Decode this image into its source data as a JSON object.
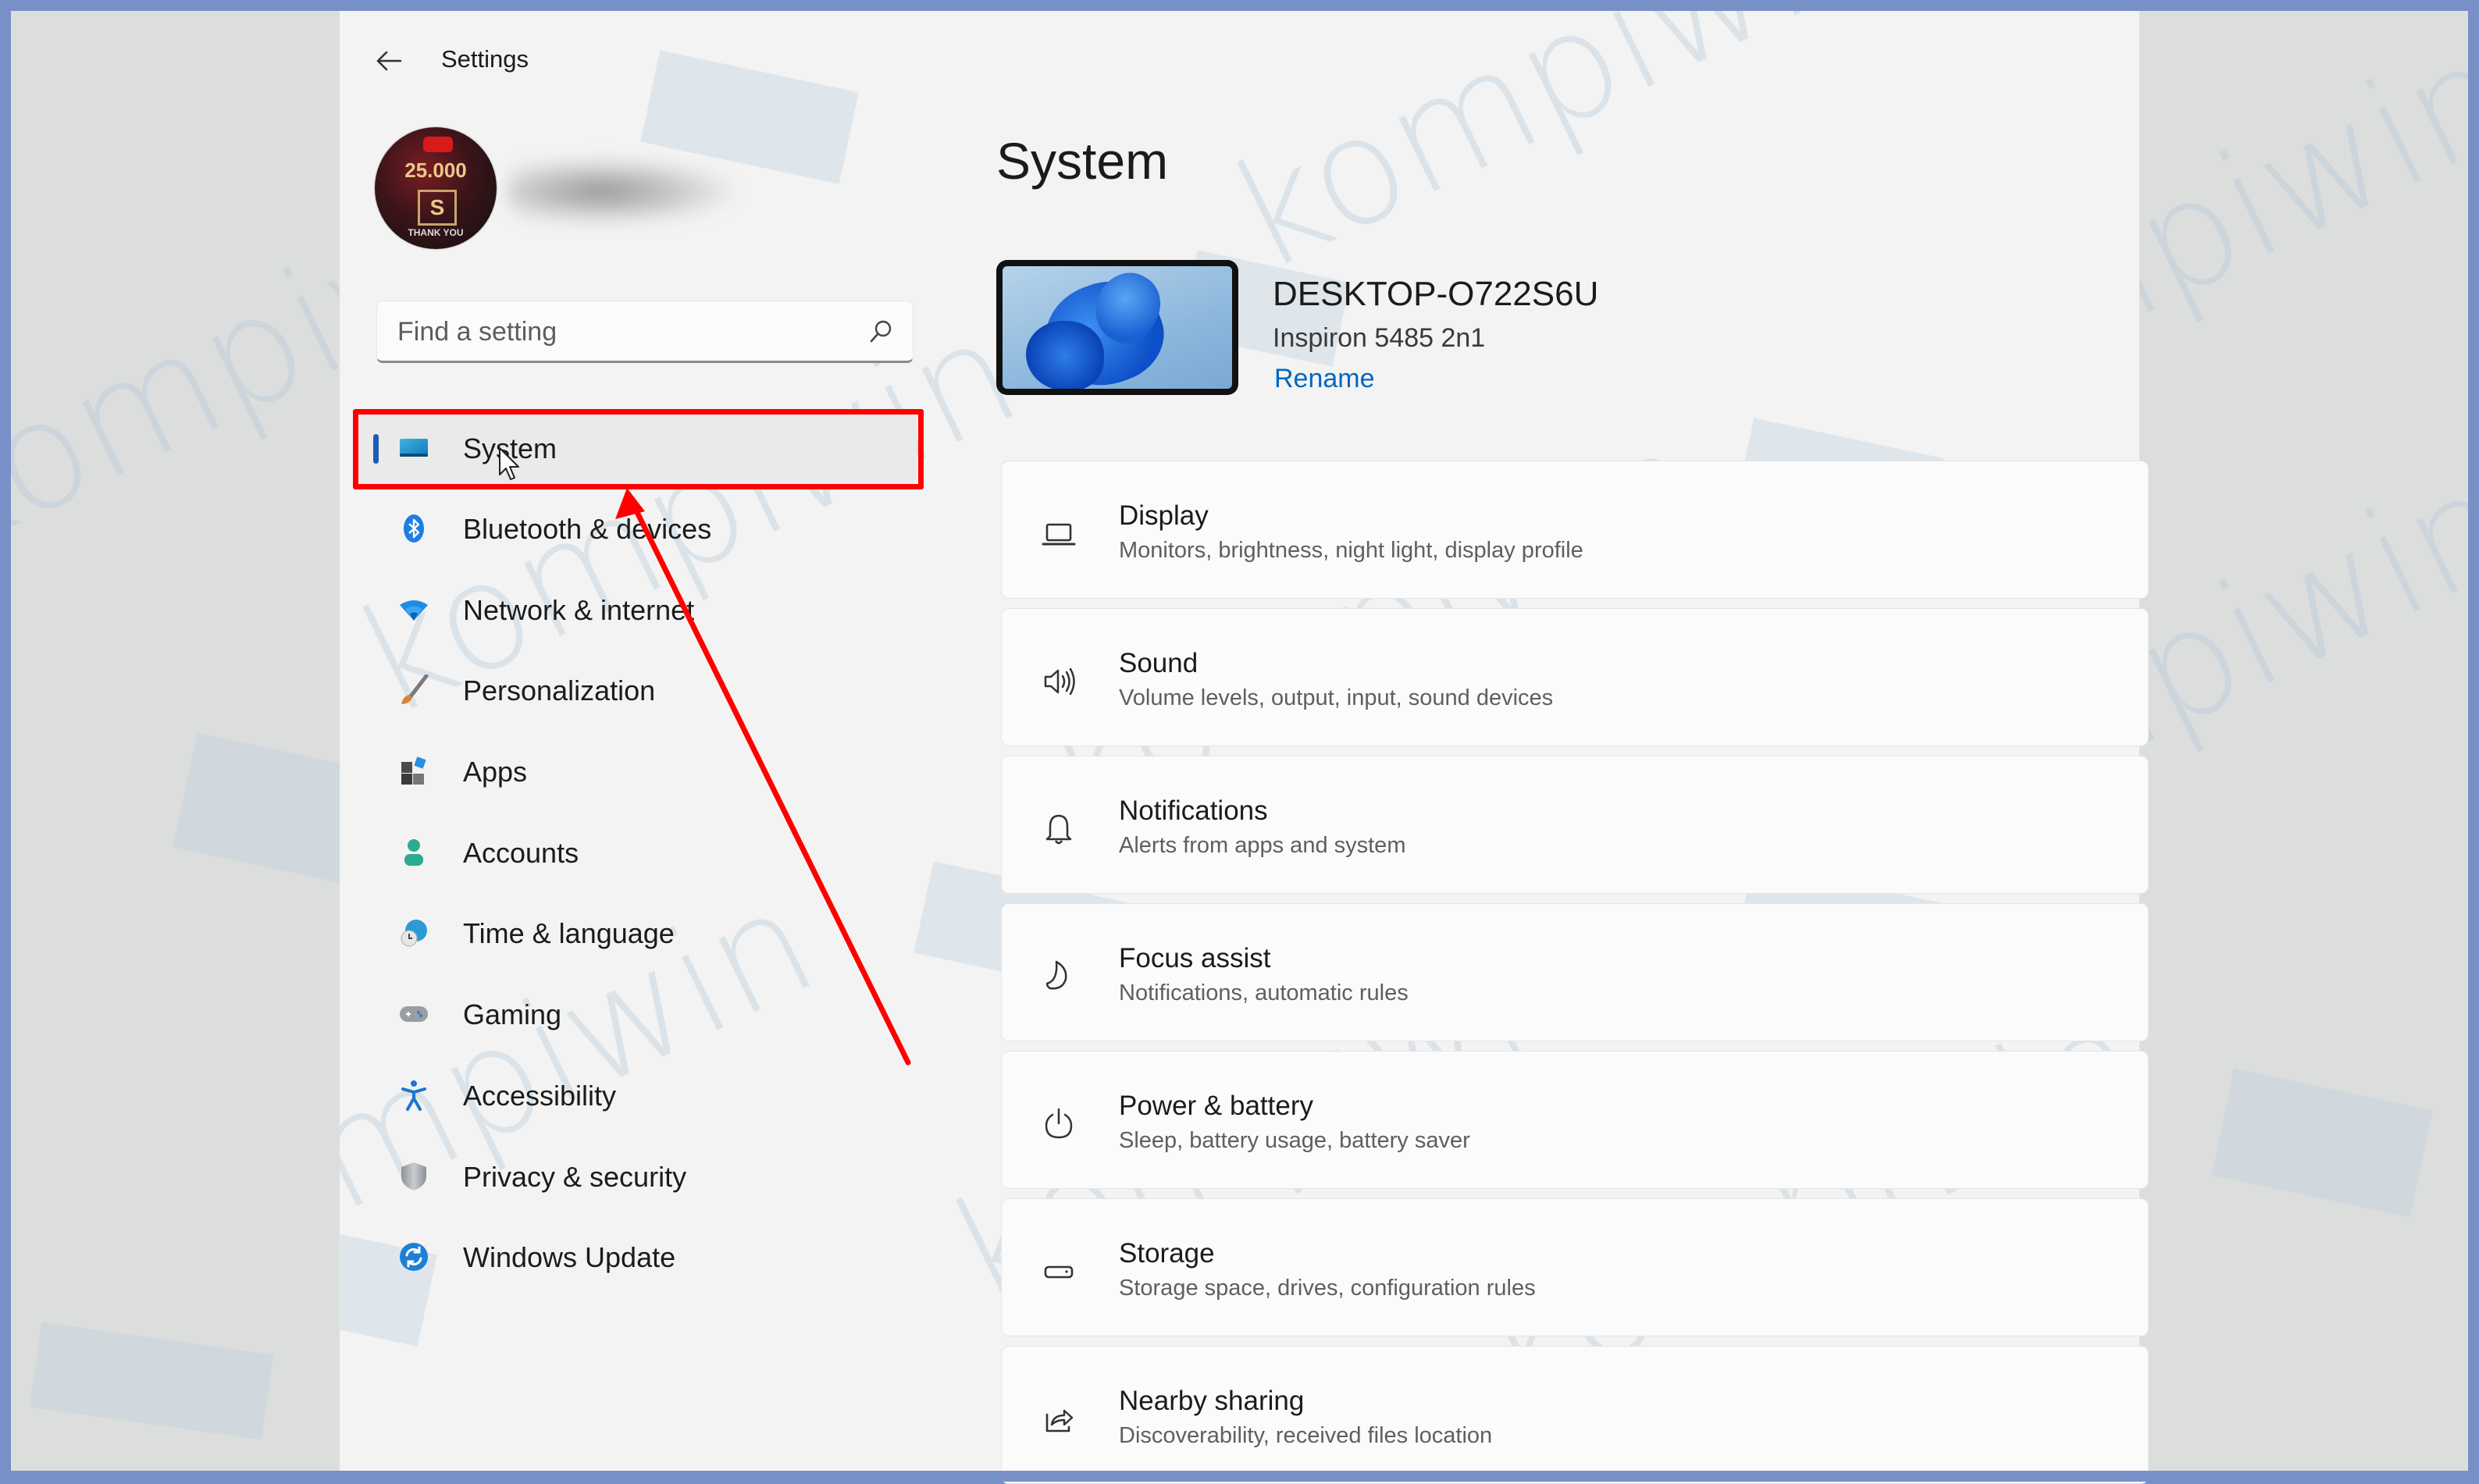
{
  "window": {
    "app_title": "Settings",
    "back_label": "Back"
  },
  "profile": {
    "avatar_text": "25.000",
    "avatar_caption": "THANK YOU",
    "avatar_logo": "S"
  },
  "search": {
    "placeholder": "Find a setting",
    "value": ""
  },
  "sidebar": {
    "items": [
      {
        "label": "System",
        "icon": "system-icon",
        "selected": true
      },
      {
        "label": "Bluetooth & devices",
        "icon": "bluetooth-icon"
      },
      {
        "label": "Network & internet",
        "icon": "wifi-icon"
      },
      {
        "label": "Personalization",
        "icon": "paintbrush-icon"
      },
      {
        "label": "Apps",
        "icon": "apps-icon"
      },
      {
        "label": "Accounts",
        "icon": "account-icon"
      },
      {
        "label": "Time & language",
        "icon": "globe-clock-icon"
      },
      {
        "label": "Gaming",
        "icon": "gamepad-icon"
      },
      {
        "label": "Accessibility",
        "icon": "accessibility-icon"
      },
      {
        "label": "Privacy & security",
        "icon": "shield-icon"
      },
      {
        "label": "Windows Update",
        "icon": "update-icon"
      }
    ]
  },
  "main": {
    "page_title": "System",
    "device": {
      "name": "DESKTOP-O722S6U",
      "model": "Inspiron 5485 2n1",
      "rename_label": "Rename"
    },
    "cards": [
      {
        "title": "Display",
        "subtitle": "Monitors, brightness, night light, display profile",
        "icon": "display-icon"
      },
      {
        "title": "Sound",
        "subtitle": "Volume levels, output, input, sound devices",
        "icon": "speaker-icon"
      },
      {
        "title": "Notifications",
        "subtitle": "Alerts from apps and system",
        "icon": "bell-icon"
      },
      {
        "title": "Focus assist",
        "subtitle": "Notifications, automatic rules",
        "icon": "moon-icon"
      },
      {
        "title": "Power & battery",
        "subtitle": "Sleep, battery usage, battery saver",
        "icon": "power-icon"
      },
      {
        "title": "Storage",
        "subtitle": "Storage space, drives, configuration rules",
        "icon": "storage-icon"
      },
      {
        "title": "Nearby sharing",
        "subtitle": "Discoverability, received files location",
        "icon": "share-icon"
      }
    ]
  },
  "annotation": {
    "highlight_color": "#ff0000",
    "target": "System"
  },
  "watermark": {
    "text": "kompiwin"
  },
  "colors": {
    "frame": "#7890c8",
    "accent": "#0067c0",
    "selection_indicator": "#1a5fb4"
  }
}
